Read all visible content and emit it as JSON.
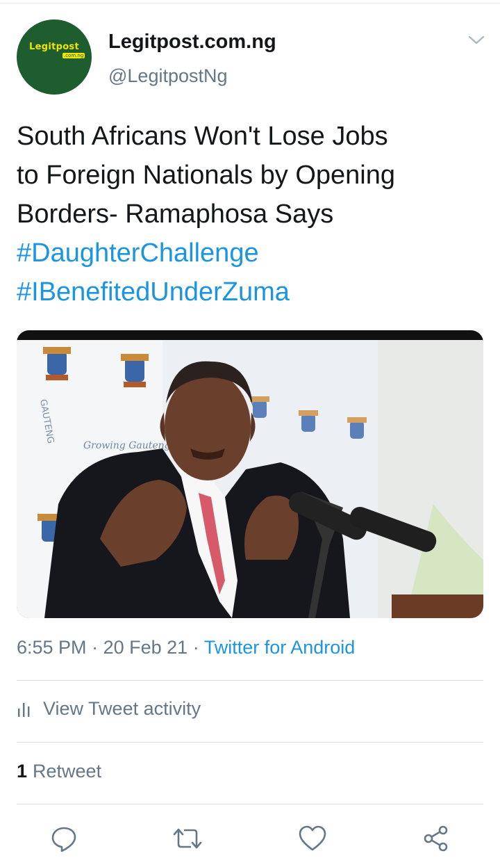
{
  "tweet": {
    "author": {
      "display_name": "Legitpost.com.ng",
      "handle": "@LegitpostNg",
      "avatar_logo_text": "Legitpost",
      "avatar_logo_sub": ".com.ng"
    },
    "text_lines": [
      "South Africans Won't Lose Jobs",
      "to Foreign Nationals by Opening",
      "Borders- Ramaphosa Says"
    ],
    "hashtags": [
      "#DaughterChallenge",
      "#IBenefitedUnderZuma"
    ],
    "media": {
      "banner_text": "GAUTENG",
      "banner_slogan": "Growing Gauteng Together"
    },
    "time": "6:55 PM",
    "separator": "·",
    "date": "20 Feb 21",
    "source": "Twitter for Android",
    "activity_label": "View Tweet activity",
    "retweet_count": "1",
    "retweet_label": "Retweet"
  },
  "icons": {
    "more": "chevron-down-icon",
    "activity": "bar-chart-icon",
    "reply": "reply-icon",
    "retweet": "retweet-icon",
    "like": "heart-icon",
    "share": "share-icon"
  },
  "colors": {
    "link": "#1b95e0",
    "secondary_text": "#657786",
    "avatar_bg": "#1e5e2e",
    "logo_yellow": "#f0e400"
  }
}
